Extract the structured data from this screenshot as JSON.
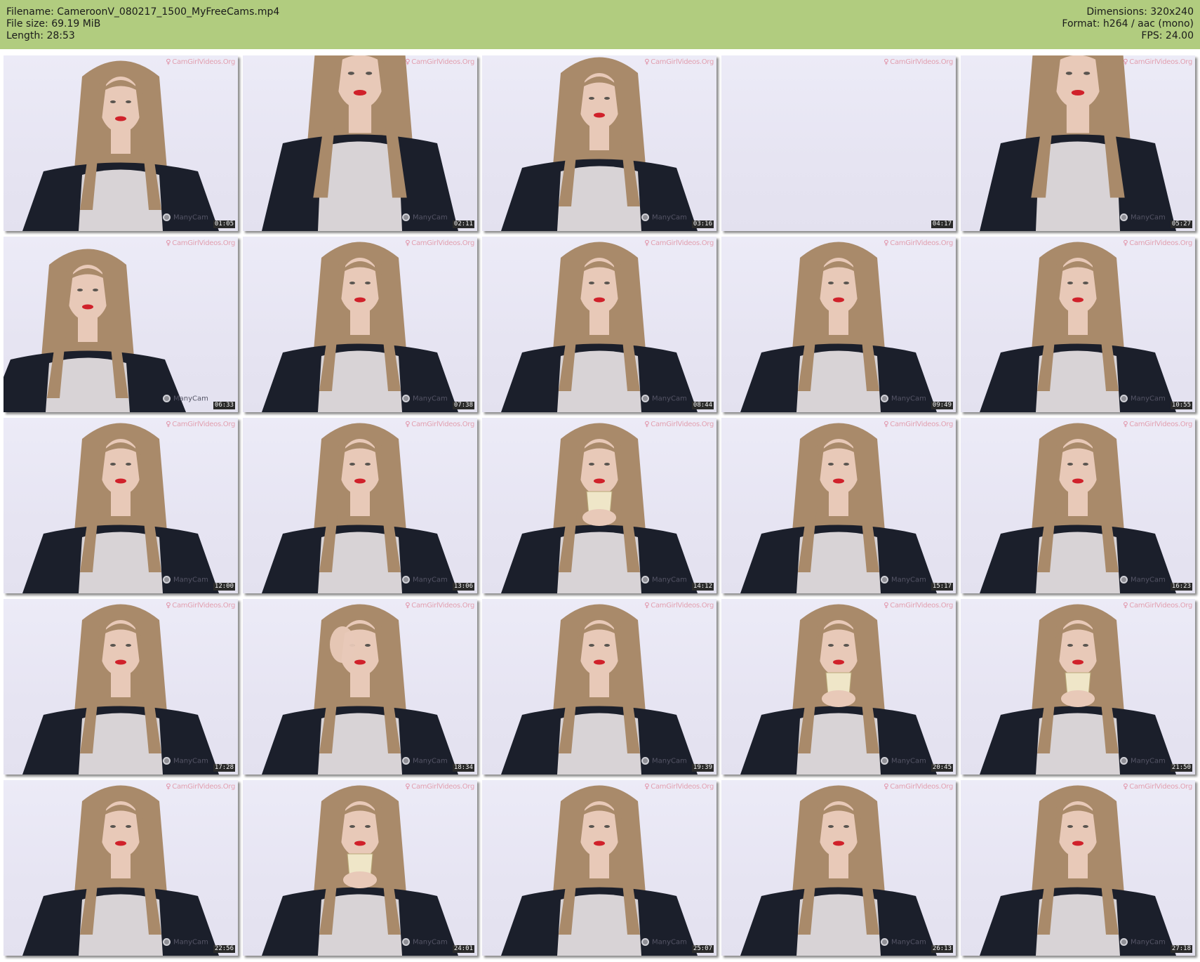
{
  "header": {
    "filename": "Filename: CameroonV_080217_1500_MyFreeCams.mp4",
    "filesize": "File size: 69.19 MiB",
    "length": "Length: 28:53",
    "dimensions": "Dimensions: 320x240",
    "format": "Format: h264 / aac (mono)",
    "fps": "FPS: 24.00"
  },
  "colors": {
    "header_bg": "#b1cc7f",
    "hair": "#a98a6a",
    "cardigan": "#1b1f2b",
    "top": "#d8d3d6",
    "skin": "#e8c9b8",
    "lips": "#d0212a"
  },
  "watermarks": {
    "site": "CamGirlVideos.Org",
    "cam": "ManyCam"
  },
  "thumbnails": [
    {
      "time": "01:05",
      "pose": "seated"
    },
    {
      "time": "02:11",
      "pose": "bend-close"
    },
    {
      "time": "03:16",
      "pose": "lean"
    },
    {
      "time": "04:17",
      "pose": "empty"
    },
    {
      "time": "05:27",
      "pose": "bend-close"
    },
    {
      "time": "06:33",
      "pose": "look-down"
    },
    {
      "time": "07:38",
      "pose": "seated"
    },
    {
      "time": "08:44",
      "pose": "seated"
    },
    {
      "time": "09:49",
      "pose": "seated"
    },
    {
      "time": "10:55",
      "pose": "seated"
    },
    {
      "time": "12:00",
      "pose": "seated"
    },
    {
      "time": "13:06",
      "pose": "seated"
    },
    {
      "time": "14:12",
      "pose": "cup"
    },
    {
      "time": "15:17",
      "pose": "seated"
    },
    {
      "time": "16:23",
      "pose": "seated"
    },
    {
      "time": "17:28",
      "pose": "seated"
    },
    {
      "time": "18:34",
      "pose": "hand-hair"
    },
    {
      "time": "19:39",
      "pose": "seated"
    },
    {
      "time": "20:45",
      "pose": "cup"
    },
    {
      "time": "21:50",
      "pose": "cup"
    },
    {
      "time": "22:56",
      "pose": "seated"
    },
    {
      "time": "24:01",
      "pose": "cup"
    },
    {
      "time": "25:07",
      "pose": "seated"
    },
    {
      "time": "26:13",
      "pose": "seated"
    },
    {
      "time": "27:18",
      "pose": "seated"
    }
  ]
}
